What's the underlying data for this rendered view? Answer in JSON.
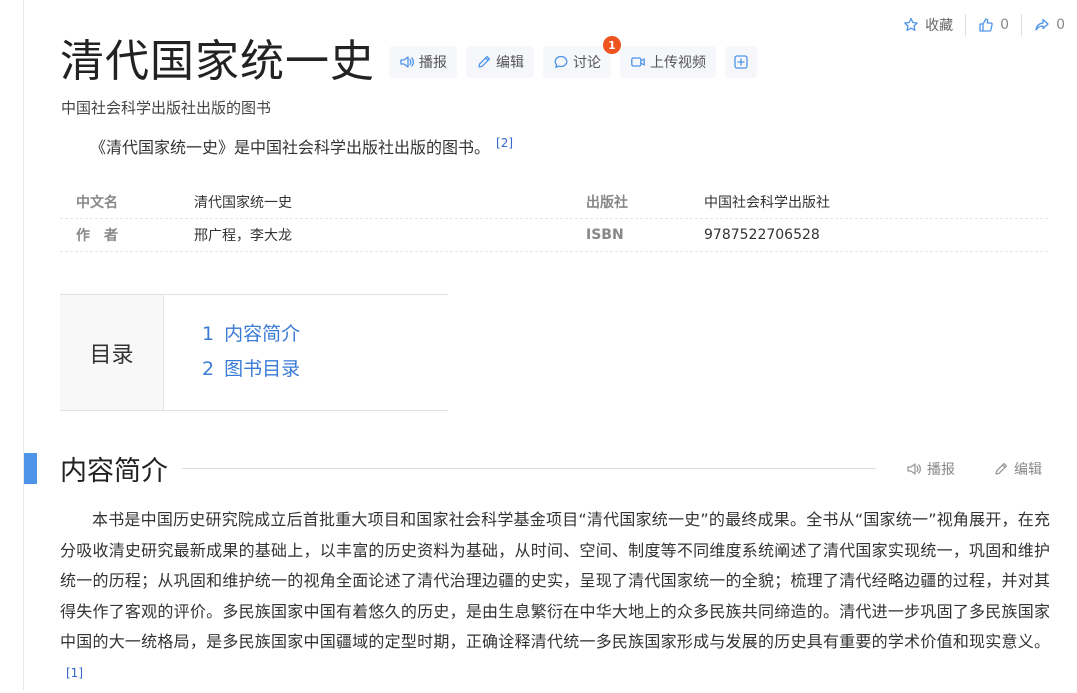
{
  "top_stats": {
    "favorite_label": "收藏",
    "likes": "0",
    "shares": "0"
  },
  "title": "清代国家统一史",
  "toolbar": {
    "read": "播报",
    "edit": "编辑",
    "discuss": "讨论",
    "discuss_badge": "1",
    "upload_video": "上传视频"
  },
  "subtitle": "中国社会科学出版社出版的图书",
  "summary": {
    "text": "《清代国家统一史》是中国社会科学出版社出版的图书。",
    "ref": "[2]"
  },
  "basic_info": [
    {
      "key": "中文名",
      "value": "清代国家统一史",
      "key2": "出版社",
      "value2": "中国社会科学出版社"
    },
    {
      "key": "作　者",
      "value": "邢广程，李大龙",
      "key2": "ISBN",
      "value2": "9787522706528"
    }
  ],
  "catalog": {
    "label": "目录",
    "items": [
      {
        "num": "1",
        "label": "内容简介"
      },
      {
        "num": "2",
        "label": "图书目录"
      }
    ]
  },
  "section": {
    "title": "内容简介",
    "read": "播报",
    "edit": "编辑",
    "paragraph": "本书是中国历史研究院成立后首批重大项目和国家社会科学基金项目“清代国家统一史”的最终成果。全书从“国家统一”视角展开，在充分吸收清史研究最新成果的基础上，以丰富的历史资料为基础，从时间、空间、制度等不同维度系统阐述了清代国家实现统一，巩固和维护统一的历程；从巩固和维护统一的视角全面论述了清代治理边疆的史实，呈现了清代国家统一的全貌；梳理了清代经略边疆的过程，并对其得失作了客观的评价。多民族国家中国有着悠久的历史，是由生息繁衍在中华大地上的众多民族共同缔造的。清代进一步巩固了多民族国家中国的大一统格局，是多民族国家中国疆域的定型时期，正确诠释清代统一多民族国家形成与发展的历史具有重要的学术价值和现实意义。",
    "ref": "[1]"
  },
  "colors": {
    "accent": "#4e94e9",
    "link": "#3a7bd5",
    "badge": "#f0541e"
  }
}
